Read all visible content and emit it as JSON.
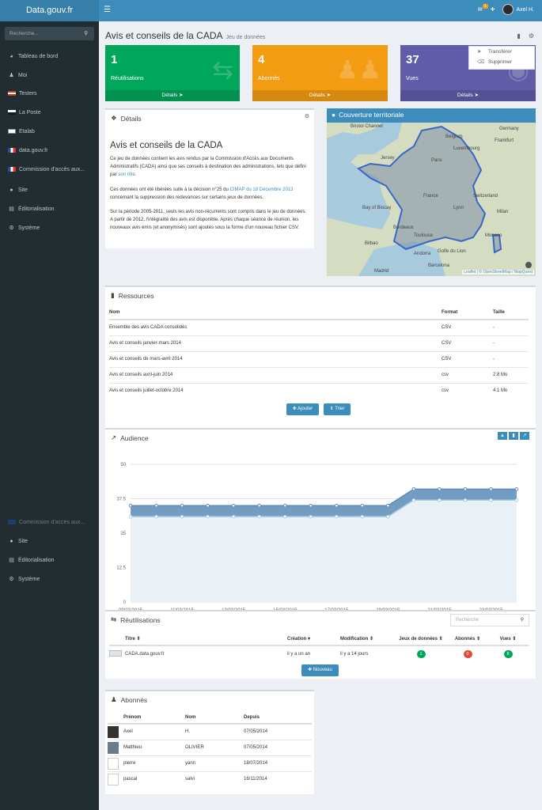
{
  "app": {
    "brand": "Data.gouv.fr",
    "menu_icon": "hamburger-icon"
  },
  "topbar": {
    "mail_badge": "1",
    "user_name": "Axel H.",
    "mail_icon": "envelope-icon",
    "plus_icon": "plus-icon"
  },
  "sidebar": {
    "search_placeholder": "Recherche...",
    "items": [
      {
        "label": "Tableau de bord",
        "icon": "dashboard-icon"
      },
      {
        "label": "Moi",
        "icon": "user-icon"
      },
      {
        "label": "Testers",
        "icon": "org-flag-icon"
      },
      {
        "label": "La Poste",
        "icon": "org-flag-icon"
      },
      {
        "label": "Etalab",
        "icon": "org-logo-icon"
      },
      {
        "label": "data.gouv.fr",
        "icon": "org-logo-icon"
      },
      {
        "label": "Commission d'accès aux...",
        "icon": "org-logo-icon"
      },
      {
        "label": "Site",
        "icon": "globe-icon"
      },
      {
        "label": "Éditorialisation",
        "icon": "newspaper-icon"
      },
      {
        "label": "Système",
        "icon": "cogs-icon"
      }
    ],
    "ghost_items": [
      {
        "label": "Site"
      },
      {
        "label": "Éditorialisation"
      },
      {
        "label": "Système"
      }
    ]
  },
  "header": {
    "title": "Avis et conseils de la CADA",
    "subtitle": "Jeu de données"
  },
  "dropdown": {
    "items": [
      "Transférer",
      "Supprimer"
    ]
  },
  "tiles": [
    {
      "value": "1",
      "label": "Réutilisations",
      "footer": "Détails",
      "color": "#00a65a"
    },
    {
      "value": "4",
      "label": "Abonnés",
      "footer": "Détails",
      "color": "#f39c12"
    },
    {
      "value": "37",
      "label": "Vues",
      "footer": "Détails",
      "color": "#605ca8"
    }
  ],
  "details": {
    "header": "Détails",
    "title": "Avis et conseils de la CADA",
    "p1": "Ce jeu de données contient les avis rendus par la Commission d'Accès aux Documents Administratifs (CADA) ainsi que ses conseils à destination des administrations, tels que défini par",
    "p1_link": "son rôle",
    "p2a": "Ces données ont été libérées suite à la décision n°25 du",
    "p2_link": "CIMAP du 18 Décembre 2013",
    "p2b": "concernant la suppression des redevances sur certains jeux de données.",
    "p3": "Sur la période 2005-2011, seuls les avis non-récurrents sont compris dans le jeu de données. A partir de 2012, l'intégralité des avis est disponible. Après chaque séance de réunion, les nouveaux avis émis (et anonymisés) sont ajoutés sous la forme d'un nouveau fichier CSV."
  },
  "map": {
    "header": "Couverture territoriale",
    "labels": [
      "Bristol Channel",
      "Belgium",
      "Germany",
      "Frankfurt",
      "Luxembourg",
      "Jersey",
      "Paris",
      "Bay of Biscay",
      "France",
      "Switzerland",
      "Milan",
      "Monaco",
      "Bordeaux",
      "Andorra",
      "Golfe du Lion",
      "Barcelona",
      "Madrid",
      "Bilbao",
      "Toulouse",
      "Lyon"
    ],
    "credit": "Leaflet | © OpenStreetMap / MapQuest"
  },
  "resources": {
    "header": "Ressources",
    "columns": [
      "Nom",
      "Format",
      "Taille"
    ],
    "rows": [
      [
        "Ensemble des avis CADA consolidés",
        "CSV",
        "-"
      ],
      [
        "Avis et conseils janvier-mars 2014",
        "CSV",
        "-"
      ],
      [
        "Avis et conseils de mars-avril 2014",
        "CSV",
        "-"
      ],
      [
        "Avis et conseils avril-juin 2014",
        "csv",
        "2.8 Mo"
      ],
      [
        "Avis et conseils juillet-octobre 2014",
        "csv",
        "4.1 Mo"
      ]
    ],
    "add_label": "Ajouter",
    "sort_label": "Trier"
  },
  "audience": {
    "header": "Audience"
  },
  "chart_data": {
    "type": "area",
    "title": "",
    "xlabel": "",
    "ylabel": "",
    "x": [
      "09/03/2015",
      "10/03/2015",
      "11/03/2015",
      "12/03/2015",
      "13/03/2015",
      "14/03/2015",
      "15/03/2015",
      "16/03/2015",
      "17/03/2015",
      "18/03/2015",
      "19/03/2015",
      "20/03/2015",
      "21/03/2015",
      "22/03/2015",
      "23/03/2015",
      "24/03/2015"
    ],
    "x_ticks": [
      "09/03/2015",
      "11/03/2015",
      "13/03/2015",
      "15/03/2015",
      "17/03/2015",
      "19/03/2015",
      "21/03/2015",
      "23/03/2015"
    ],
    "y_ticks": [
      "0",
      "12.5",
      "25",
      "37.5",
      "50"
    ],
    "ylim": [
      0,
      50
    ],
    "grid": true,
    "series": [
      {
        "values": [
          35,
          35,
          35,
          35,
          35,
          35,
          35,
          35,
          35,
          35,
          35,
          41,
          41,
          41,
          41,
          41
        ],
        "color": "#5b8bb8"
      },
      {
        "values": [
          31,
          31,
          31,
          31,
          31,
          31,
          31,
          31,
          31,
          31,
          31,
          37,
          37,
          37,
          37,
          37
        ],
        "color": "#a7cde6"
      }
    ]
  },
  "reuses": {
    "header": "Réutilisations",
    "search_placeholder": "Recherche",
    "columns": [
      "Titre",
      "Création",
      "Modification",
      "Jeux de données",
      "Abonnés",
      "Vues"
    ],
    "rows": [
      {
        "title": "CADA.data.gouv.fr",
        "created": "il y a un an",
        "modified": "il y a 14 jours",
        "datasets": "1",
        "followers": "0",
        "views": "8"
      }
    ],
    "new_label": "Nouveau"
  },
  "followers": {
    "header": "Abonnés",
    "columns": [
      "Prénom",
      "Nom",
      "Depuis"
    ],
    "rows": [
      [
        "Axel",
        "H.",
        "07/05/2014"
      ],
      [
        "Matthieu",
        "OLIVIER",
        "07/05/2014"
      ],
      [
        "pierre",
        "yann",
        "18/07/2014"
      ],
      [
        "pascal",
        "salvi",
        "16/11/2014"
      ]
    ]
  }
}
